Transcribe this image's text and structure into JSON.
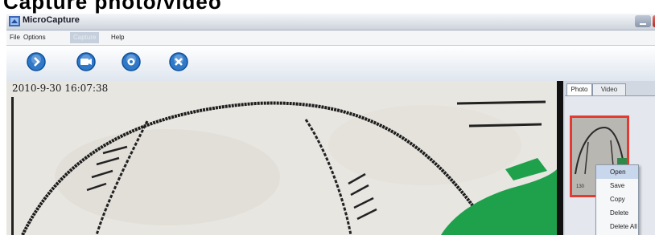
{
  "caption": {
    "text": "Capture photo/video"
  },
  "window": {
    "title": "MicroCapture"
  },
  "menubar": {
    "items": [
      {
        "label": "File",
        "disabled": false
      },
      {
        "label": "Options",
        "disabled": false
      },
      {
        "label": "Capture",
        "disabled": true
      },
      {
        "label": "Help",
        "disabled": false
      }
    ]
  },
  "toolbar": {
    "buttons": [
      {
        "icon": "snapshot-icon"
      },
      {
        "icon": "video-record-icon"
      },
      {
        "icon": "preview-icon"
      },
      {
        "icon": "close-circle-icon"
      }
    ]
  },
  "preview": {
    "timestamp": "2010-9-30 16:07:38"
  },
  "sidepanel": {
    "tabs": [
      {
        "label": "Photo",
        "active": true
      },
      {
        "label": "Video",
        "active": false
      }
    ],
    "thumbnail": {
      "caption": "130",
      "selected": true
    }
  },
  "context_menu": {
    "items": [
      {
        "label": "Open",
        "highlighted": true
      },
      {
        "label": "Save",
        "highlighted": false
      },
      {
        "label": "Copy",
        "highlighted": false
      },
      {
        "label": "Delete",
        "highlighted": false
      },
      {
        "label": "Delete All",
        "highlighted": false
      }
    ]
  },
  "colors": {
    "title_gradient_top": "#f4f6f9",
    "toolbar_icon_blue": "#2f79c8",
    "selection_red": "#e53a31",
    "stain_green": "#1fa14c"
  }
}
